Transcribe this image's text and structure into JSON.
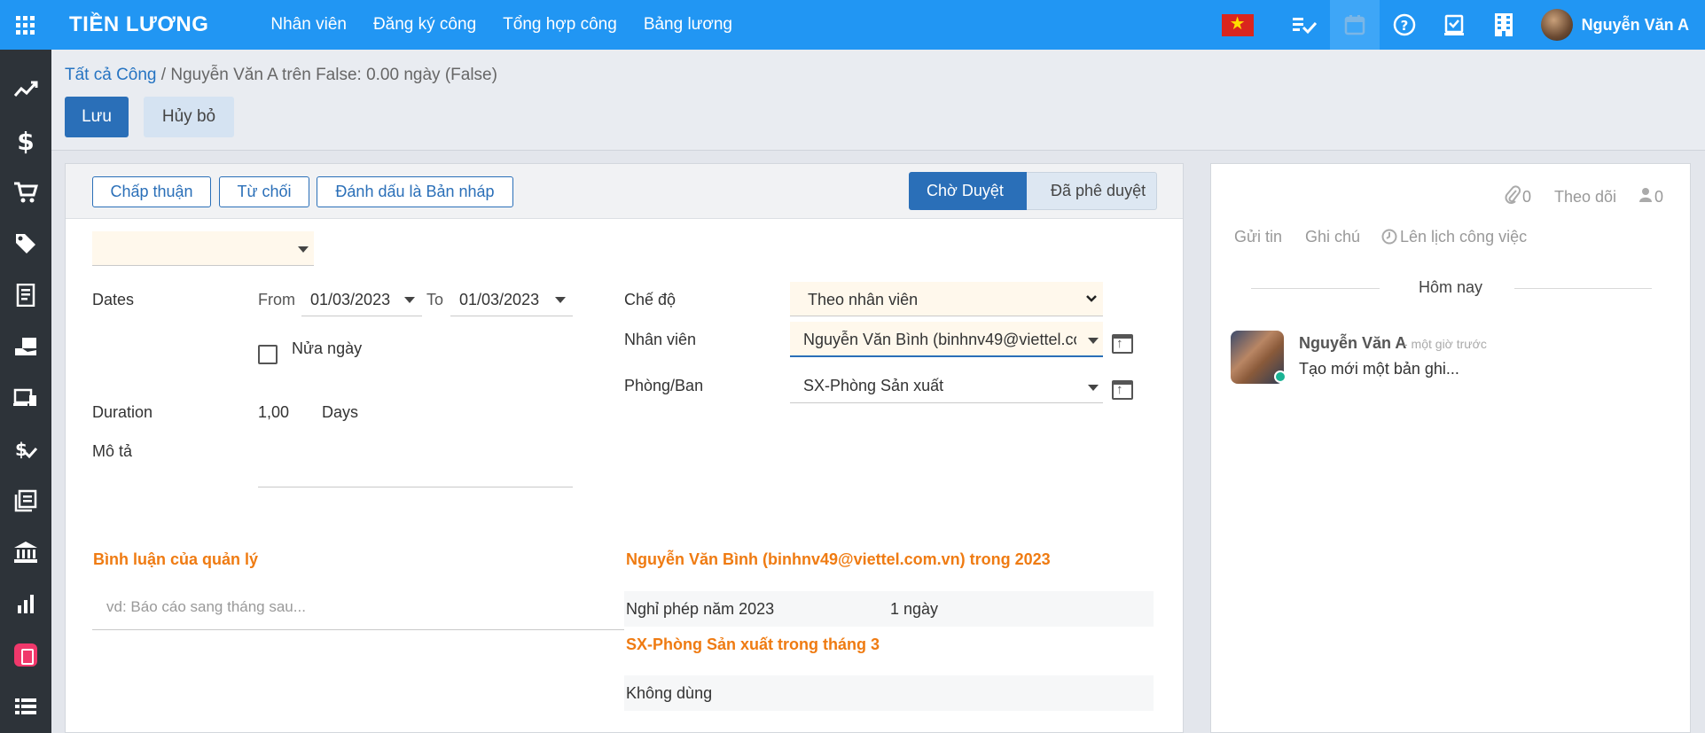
{
  "topbar": {
    "app_title": "TIỀN LƯƠNG",
    "menu": [
      "Nhân viên",
      "Đăng ký công",
      "Tổng hợp công",
      "Bảng lương"
    ],
    "user_name": "Nguyễn Văn A"
  },
  "control_panel": {
    "breadcrumb_parent": "Tất cả Công",
    "breadcrumb_current": "Nguyễn Văn A trên False: 0.00 ngày (False)",
    "save_label": "Lưu",
    "cancel_label": "Hủy bỏ"
  },
  "statusbar": {
    "approve_label": "Chấp thuận",
    "refuse_label": "Từ chối",
    "draft_label": "Đánh dấu là Bản nháp",
    "stages": [
      "Chờ Duyệt",
      "Đã phê duyệt"
    ]
  },
  "form": {
    "dates_label": "Dates",
    "from_label": "From",
    "from_value": "01/03/2023",
    "to_label": "To",
    "to_value": "01/03/2023",
    "half_day_label": "Nửa ngày",
    "duration_label": "Duration",
    "duration_value": "1,00",
    "duration_unit": "Days",
    "description_label": "Mô tả",
    "mode_label": "Chế độ",
    "mode_value": "Theo nhân viên",
    "employee_label": "Nhân viên",
    "employee_value": "Nguyễn Văn Bình (binhnv49@viettel.com.vn)",
    "department_label": "Phòng/Ban",
    "department_value": "SX-Phòng Sản xuất",
    "manager_comment_title": "Bình luận của quản lý",
    "manager_comment_placeholder": "vd: Báo cáo sang tháng sau...",
    "employee_summary_title": "Nguyễn Văn Bình (binhnv49@viettel.com.vn) trong 2023",
    "leave_row_label": "Nghỉ phép năm 2023",
    "leave_row_value": "1 ngày",
    "department_summary_title": "SX-Phòng Sản xuất trong tháng 3",
    "department_row_label": "Không dùng"
  },
  "chatter": {
    "attachments_count": "0",
    "follow_label": "Theo dõi",
    "followers_count": "0",
    "send_message_label": "Gửi tin",
    "log_note_label": "Ghi chú",
    "schedule_label": "Lên lịch công việc",
    "today_label": "Hôm nay",
    "message_author": "Nguyễn Văn A",
    "message_time": "- một giờ trước",
    "message_body": "Tạo mới một bản ghi..."
  },
  "colors": {
    "topbar": "#2196f3",
    "sidebar": "#2d3339",
    "primary": "#2a6fb8",
    "accent_orange": "#ef7b12"
  }
}
